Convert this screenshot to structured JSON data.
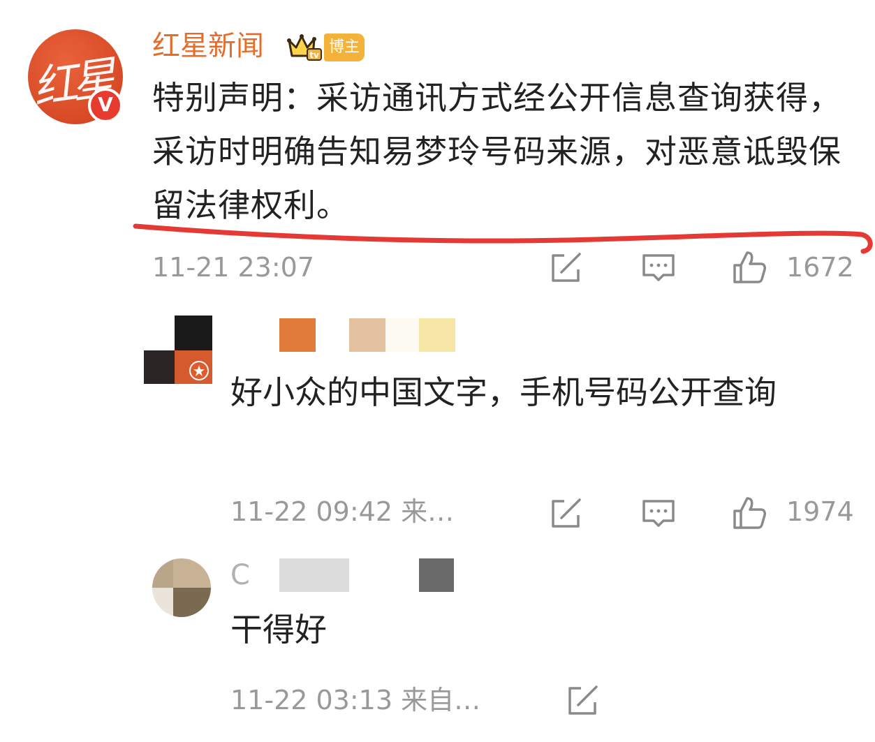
{
  "post": {
    "author": {
      "name": "红星新闻",
      "avatar_text": "红星",
      "verified_mark": "V",
      "badge_label": "博主",
      "badge_icon": "crown-icon"
    },
    "text": "特别声明：采访通讯方式经公开信息查询获得，采访时明确告知易梦玲号码来源，对恶意诋毁保留法律权利。",
    "timestamp": "11-21 23:07",
    "likes": "1672",
    "icons": [
      "repost-icon",
      "comment-icon",
      "like-icon"
    ],
    "highlight_color": "#e53935"
  },
  "comments": [
    {
      "username": "",
      "text": "好小众的中国文字，手机号码公开查询",
      "timestamp": "11-22 09:42 来…",
      "likes": "1974"
    },
    {
      "username_visible": "C",
      "text": "干得好",
      "timestamp": "11-22 03:13 来自…"
    }
  ],
  "colors": {
    "author_name": "#e56d2a",
    "meta_gray": "#999999",
    "text": "#222222"
  }
}
